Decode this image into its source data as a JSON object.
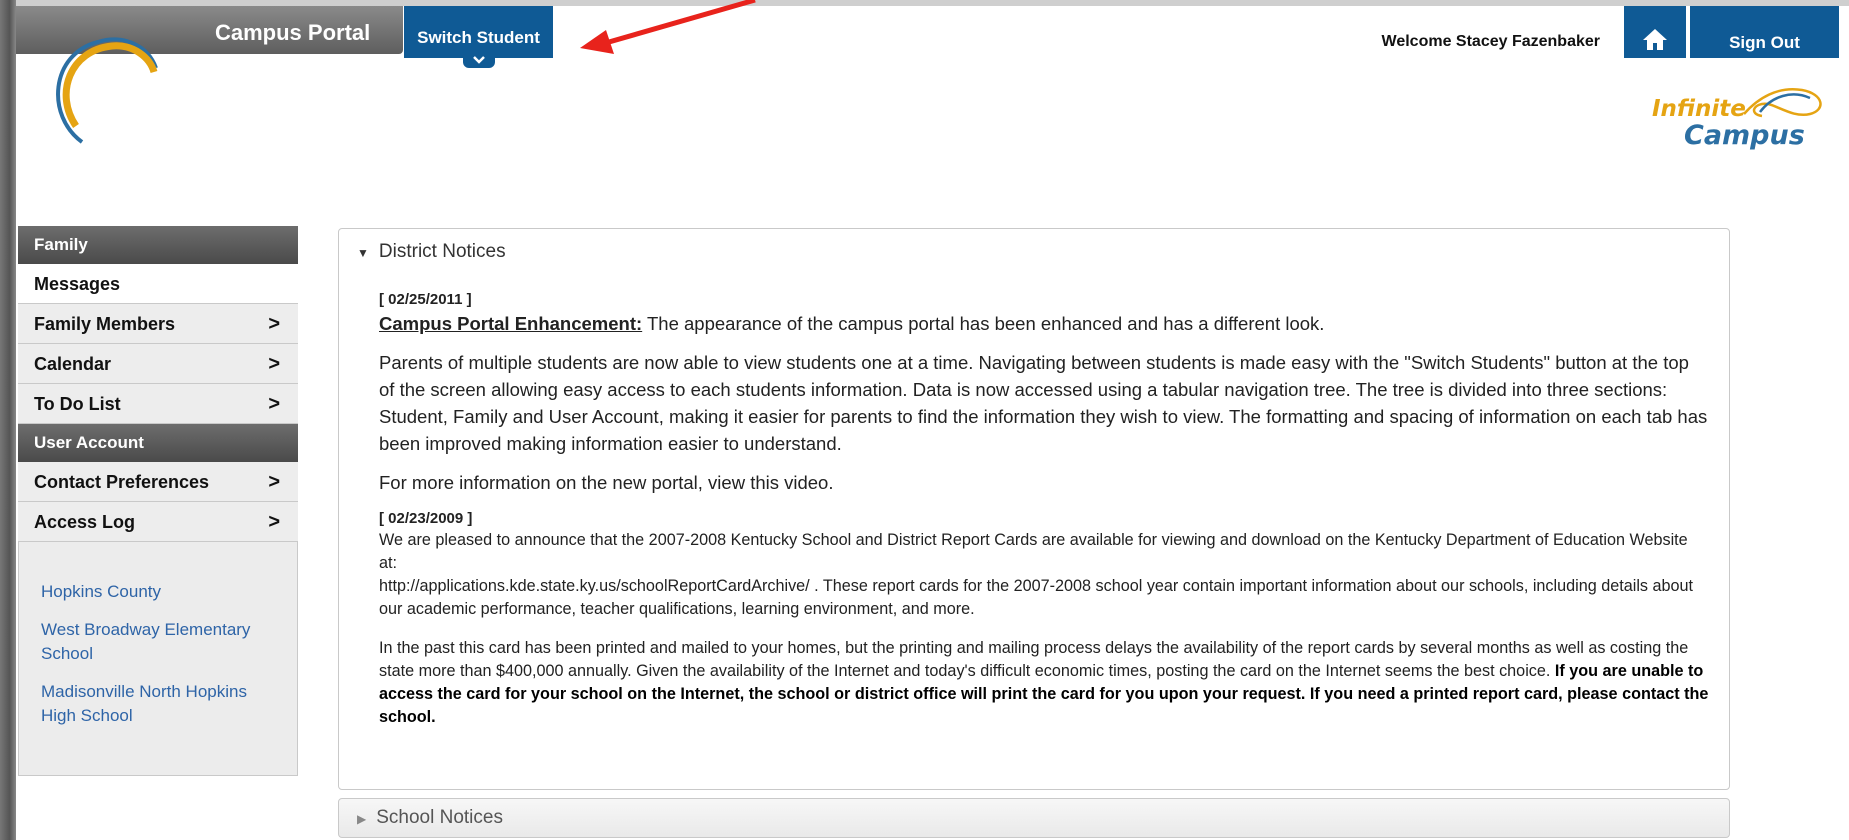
{
  "header": {
    "portal_title": "Campus Portal",
    "switch_student_label": "Switch Student",
    "welcome_text": "Welcome Stacey Fazenbaker",
    "sign_out_label": "Sign Out",
    "brand_logo_top": "Infinite",
    "brand_logo_bottom": "Campus"
  },
  "sidebar": {
    "sections": [
      {
        "header": "Family",
        "items": [
          {
            "label": "Messages",
            "chevron": false
          },
          {
            "label": "Family Members",
            "chevron": true
          },
          {
            "label": "Calendar",
            "chevron": true
          },
          {
            "label": "To Do List",
            "chevron": true
          }
        ]
      },
      {
        "header": "User Account",
        "items": [
          {
            "label": "Contact Preferences",
            "chevron": true
          },
          {
            "label": "Access Log",
            "chevron": true
          }
        ]
      }
    ],
    "chevron_glyph": ">",
    "schools": [
      "Hopkins County",
      "West Broadway Elementary School",
      "Madisonville North Hopkins High School"
    ]
  },
  "main": {
    "district_notices_title": "District Notices",
    "notice1": {
      "date": "[ 02/25/2011 ]",
      "headline": "Campus Portal Enhancement:",
      "headline_rest": " The appearance of the campus portal has been enhanced and has a different look.",
      "para2": "Parents of multiple students are now able to view students one at a time. Navigating between students is made easy with the \"Switch Students\" button at the top of the screen allowing easy access to each students information. Data is now accessed using a tabular navigation tree. The tree is divided into three sections: Student, Family and User Account, making it easier for parents to find the information they wish to view. The formatting and spacing of information on each tab has been improved making information easier to understand.",
      "para3": "For more information on the new portal, view  this video."
    },
    "notice2": {
      "date": "[ 02/23/2009 ]",
      "para1": "We are pleased to announce that the 2007-2008 Kentucky School and District Report Cards are available for viewing and download on the Kentucky Department of Education Website at:",
      "para1b": " http://applications.kde.state.ky.us/schoolReportCardArchive/  . These report cards for the 2007-2008 school year contain important information about our schools, including details about our academic performance, teacher qualifications, learning environment, and more.",
      "para2": "In the past this card has been printed and mailed to your homes, but the printing and mailing process delays the availability of the report cards by several months as well as costing the state more than $400,000 annually.   Given the availability of the Internet and today's difficult economic times, posting the card on the Internet seems the best choice. ",
      "para2_bold": "If you are unable to access the card for your school on the Internet, the school or district office will print the card for you upon your request. If you need a printed report card, please contact the school."
    },
    "school_notices_title": "School Notices"
  },
  "colors": {
    "accent_blue": "#0f5a95",
    "link_blue": "#2e64a7",
    "logo_gold": "#e5a413",
    "annotation_red": "#e8231c"
  }
}
